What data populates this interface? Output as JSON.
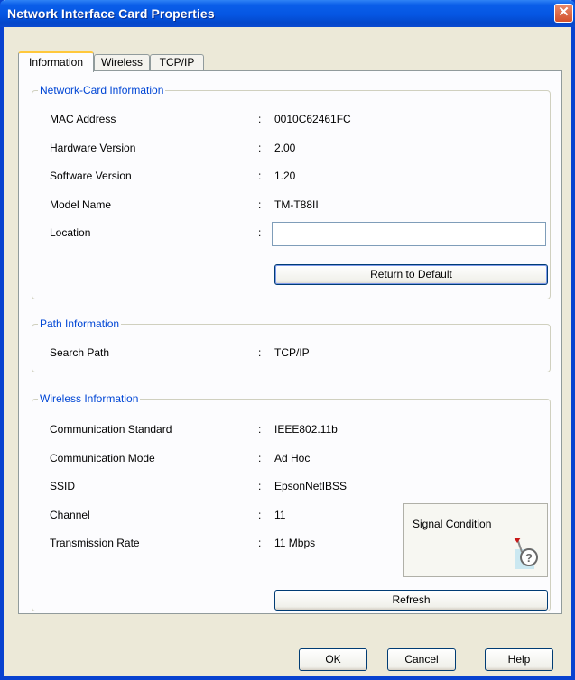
{
  "window": {
    "title": "Network Interface Card Properties",
    "close_glyph": "✕"
  },
  "tabs": [
    {
      "label": "Information",
      "active": true
    },
    {
      "label": "Wireless",
      "active": false
    },
    {
      "label": "TCP/IP",
      "active": false
    }
  ],
  "network_card": {
    "title": "Network-Card Information",
    "rows": [
      {
        "label": "MAC Address",
        "value": "0010C62461FC"
      },
      {
        "label": "Hardware Version",
        "value": "2.00"
      },
      {
        "label": "Software Version",
        "value": "1.20"
      },
      {
        "label": "Model Name",
        "value": "TM-T88II"
      }
    ],
    "location_label": "Location",
    "location_value": "",
    "return_default_label": "Return to Default"
  },
  "path": {
    "title": "Path Information",
    "search_path_label": "Search Path",
    "search_path_value": "TCP/IP"
  },
  "wireless": {
    "title": "Wireless Information",
    "rows": [
      {
        "label": "Communication Standard",
        "value": "IEEE802.11b"
      },
      {
        "label": "Communication Mode",
        "value": "Ad Hoc"
      },
      {
        "label": "SSID",
        "value": "EpsonNetIBSS"
      },
      {
        "label": "Channel",
        "value": "11"
      },
      {
        "label": "Transmission Rate",
        "value": "11 Mbps"
      }
    ],
    "signal_label": "Signal Condition",
    "refresh_label": "Refresh"
  },
  "colon": ":",
  "buttons": {
    "ok": "OK",
    "cancel": "Cancel",
    "help": "Help"
  },
  "colors": {
    "title_bar": "#0556e3",
    "group_title": "#0046d5",
    "window_bg": "#ece9d8"
  }
}
